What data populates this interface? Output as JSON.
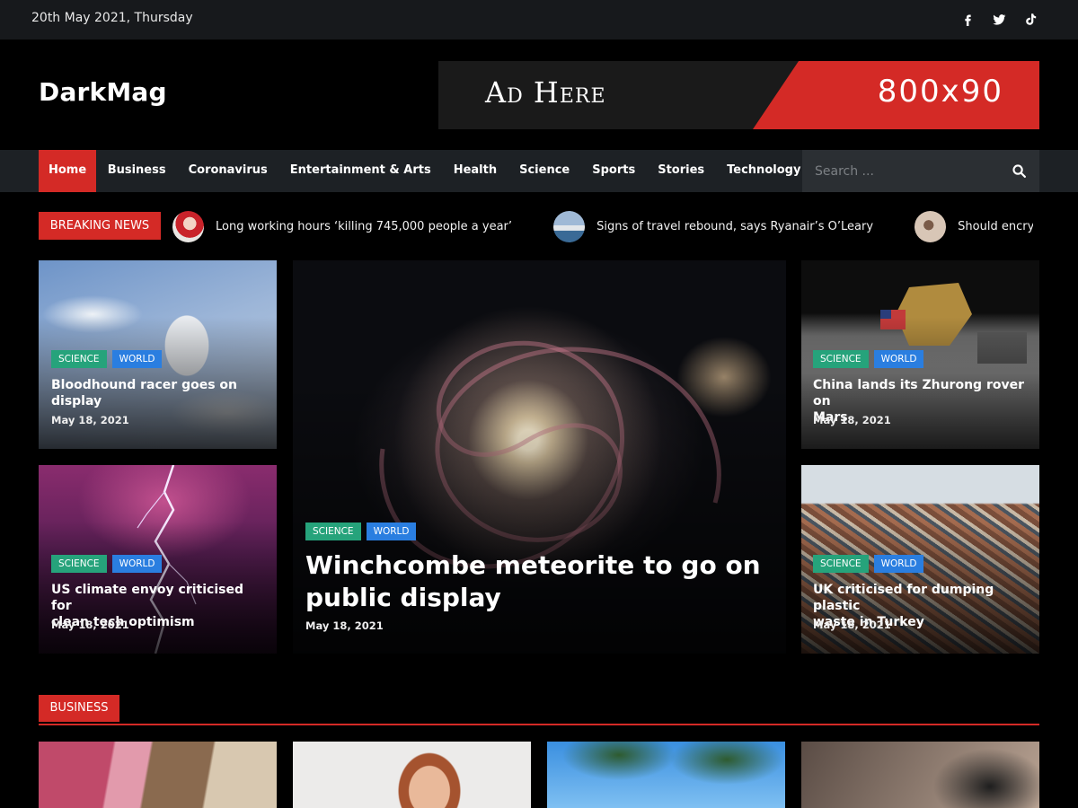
{
  "topbar": {
    "date": "20th May 2021, Thursday",
    "social": [
      "facebook-icon",
      "twitter-icon",
      "tiktok-icon"
    ]
  },
  "header": {
    "logo": "DarkMag",
    "ad_text": "Ad Here",
    "ad_size": "800x90"
  },
  "nav": {
    "items": [
      "Home",
      "Business",
      "Coronavirus",
      "Entertainment & Arts",
      "Health",
      "Science",
      "Sports",
      "Stories",
      "Technology"
    ],
    "active": "Home",
    "search_placeholder": "Search ..."
  },
  "breaking": {
    "label": "BREAKING NEWS",
    "items": [
      "Long working hours ‘killing 745,000 people a year’",
      "Signs of travel rebound, says Ryanair’s O’Leary",
      "Should encryption be c"
    ]
  },
  "cards": {
    "c1": {
      "tags": [
        "SCIENCE",
        "WORLD"
      ],
      "title_l1": "Bloodhound racer goes on",
      "title_l2": "display",
      "date": "May 18, 2021"
    },
    "c2": {
      "tags": [
        "SCIENCE",
        "WORLD"
      ],
      "title_l1": "US climate envoy criticised for",
      "title_l2": "clean tech optimism",
      "date": "May 18, 2021"
    },
    "main": {
      "tags": [
        "SCIENCE",
        "WORLD"
      ],
      "title_l1": "Winchcombe meteorite to go on",
      "title_l2": "public display",
      "date": "May 18, 2021"
    },
    "c3": {
      "tags": [
        "SCIENCE",
        "WORLD"
      ],
      "title_l1": "China lands its Zhurong rover on",
      "title_l2": "Mars",
      "date": "May 18, 2021"
    },
    "c4": {
      "tags": [
        "SCIENCE",
        "WORLD"
      ],
      "title_l1": "UK criticised for dumping plastic",
      "title_l2": "waste in Turkey",
      "date": "May 18, 2021"
    }
  },
  "section": {
    "label": "BUSINESS"
  },
  "colors": {
    "accent": "#d42a26",
    "science": "#26a37b",
    "world": "#2a7ee0",
    "topbar": "#17191c",
    "nav": "#1d2125"
  }
}
